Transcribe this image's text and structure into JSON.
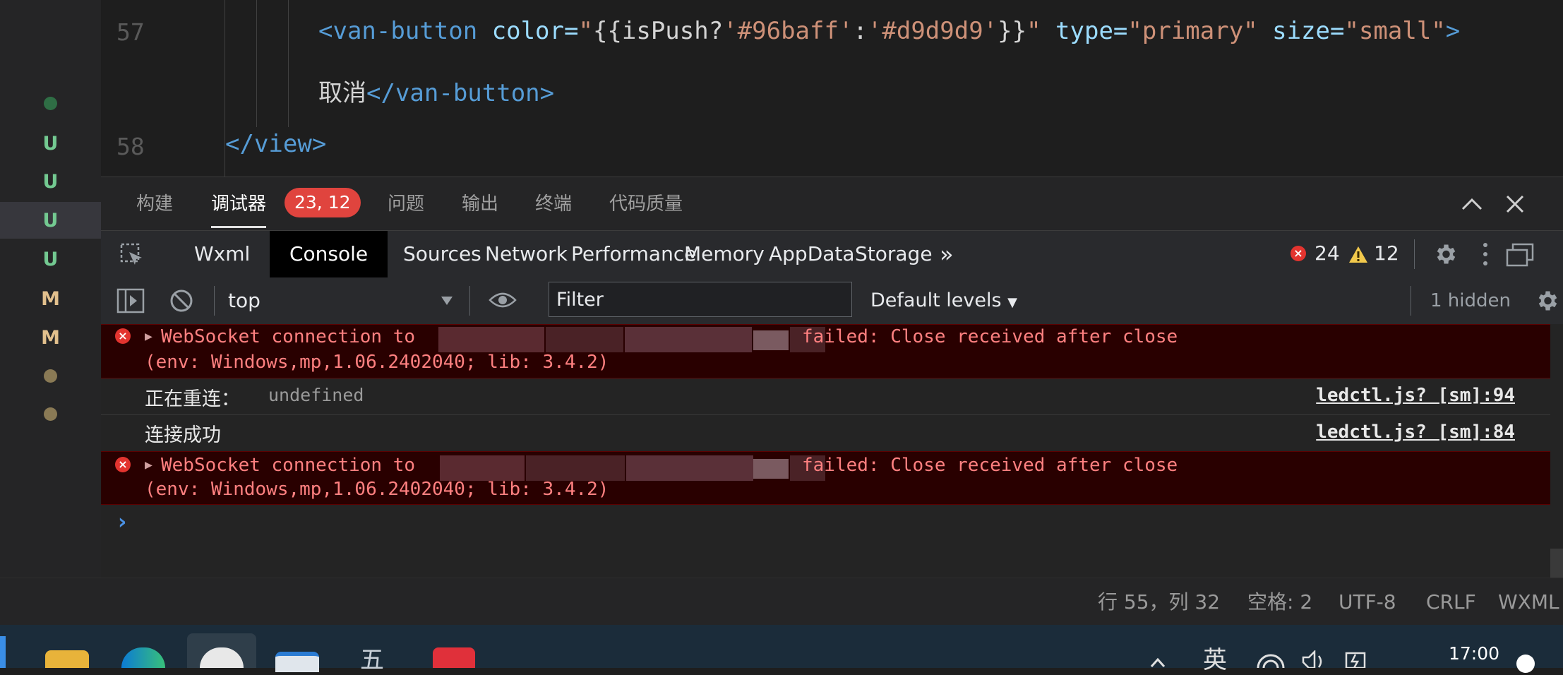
{
  "git_status": [
    "●",
    "U",
    "U",
    "U",
    "U",
    "M",
    "M",
    "●",
    "●"
  ],
  "editor": {
    "lines": [
      {
        "num": "57"
      },
      {
        "num": "58"
      }
    ],
    "code57": {
      "open_tag": "<van-button",
      "attr_color": " color=",
      "quote1": "\"",
      "expr_open": "{{isPush?",
      "val1": "'#96baff'",
      "colon": ":",
      "val2": "'#d9d9d9'",
      "expr_close": "}}",
      "quote2": "\"",
      "attr_type": " type=",
      "type_val": "\"primary\"",
      "attr_size": " size=",
      "size_val": "\"small\"",
      "close_bracket": ">"
    },
    "code57b": {
      "text": "取消",
      "close_tag": "</van-button>"
    },
    "code58": {
      "close_view": "</view>"
    }
  },
  "panel_tabs": {
    "build": "构建",
    "debugger": "调试器",
    "badge": "23, 12",
    "problems": "问题",
    "output": "输出",
    "terminal": "终端",
    "quality": "代码质量"
  },
  "devtools": {
    "tabs": [
      "Wxml",
      "Console",
      "Sources",
      "Network",
      "Performance",
      "Memory",
      "AppData",
      "Storage"
    ],
    "more": "»",
    "error_count": "24",
    "warning_count": "12"
  },
  "console_toolbar": {
    "context": "top",
    "filter_placeholder": "Filter",
    "levels": "Default levels",
    "hidden": "1 hidden"
  },
  "console": {
    "err1_a": "WebSocket connection to",
    "err1_b": "failed: Close received after close",
    "err1_env": "(env: Windows,mp,1.06.2402040; lib: 3.4.2)",
    "log1_label": "正在重连：",
    "log1_value": "undefined",
    "log1_src": "ledctl.js? [sm]:94",
    "log2_label": "连接成功",
    "log2_src": "ledctl.js? [sm]:84",
    "err2_a": "WebSocket connection to",
    "err2_b": "failed: Close received after close",
    "err2_env": "(env: Windows,mp,1.06.2402040; lib: 3.4.2)",
    "prompt": "›"
  },
  "statusbar": {
    "position": "行 55，列 32",
    "spaces": "空格: 2",
    "encoding": "UTF-8",
    "eol": "CRLF",
    "lang": "WXML"
  },
  "taskbar": {
    "ime": "英",
    "time": "17:00",
    "text_icon": "五"
  },
  "colors": {
    "git_untracked": "#73c991",
    "git_modified": "#e2c08d",
    "badge": "#e0443e",
    "error_bg": "#290000"
  }
}
